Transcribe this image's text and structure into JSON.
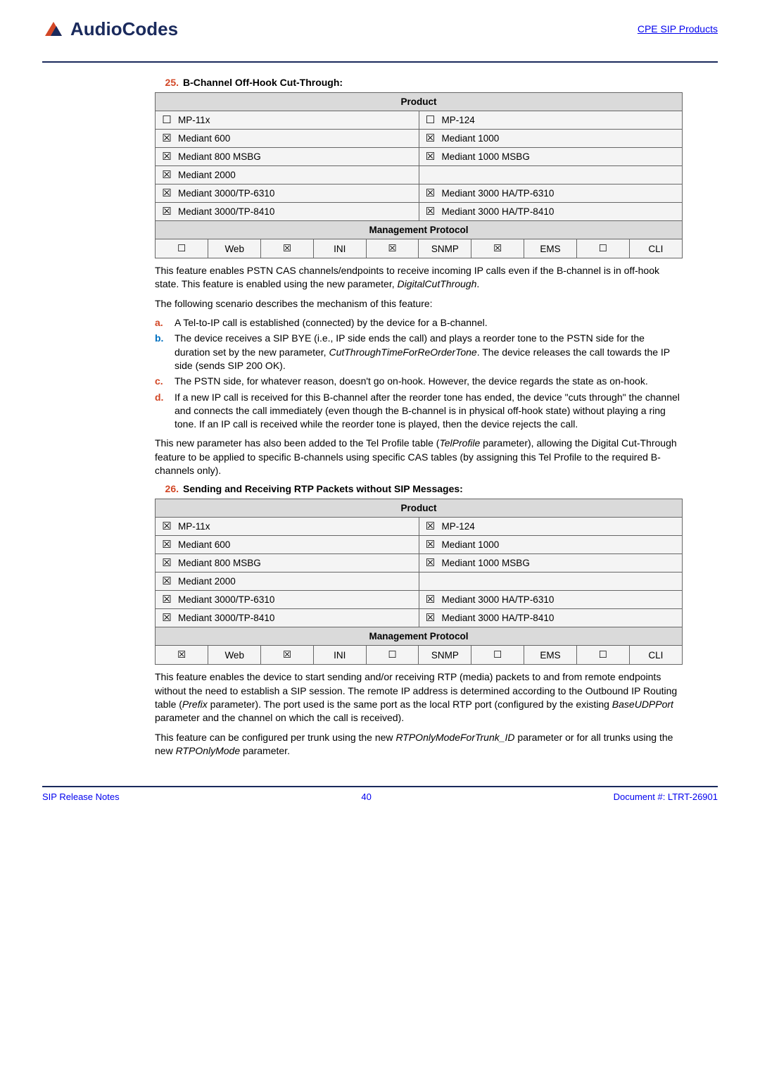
{
  "header": {
    "logo_text": "AudioCodes",
    "product_link": "CPE SIP Products"
  },
  "item25": {
    "number": "25.",
    "title": "B-Channel Off-Hook Cut-Through:",
    "table": {
      "head": "Product",
      "rows": [
        {
          "l_chk": "☐",
          "l": "MP-11x",
          "r_chk": "☐",
          "r": "MP-124"
        },
        {
          "l_chk": "☒",
          "l": "Mediant 600",
          "r_chk": "☒",
          "r": "Mediant 1000"
        },
        {
          "l_chk": "☒",
          "l": "Mediant 800 MSBG",
          "r_chk": "☒",
          "r": "Mediant 1000 MSBG"
        },
        {
          "l_chk": "☒",
          "l": "Mediant 2000",
          "r_chk": "",
          "r": ""
        },
        {
          "l_chk": "☒",
          "l": "Mediant 3000/TP-6310",
          "r_chk": "☒",
          "r": "Mediant 3000 HA/TP-6310"
        },
        {
          "l_chk": "☒",
          "l": "Mediant 3000/TP-8410",
          "r_chk": "☒",
          "r": "Mediant 3000 HA/TP-8410"
        }
      ],
      "mgmt_head": "Management Protocol",
      "mgmt": {
        "web_chk": "☐",
        "web": "Web",
        "ini_chk": "☒",
        "ini": "INI",
        "snmp_chk": "☒",
        "snmp": "SNMP",
        "ems_chk": "☒",
        "ems": "EMS",
        "cli_chk": "☐",
        "cli": "CLI"
      }
    },
    "para1_a": "This feature enables PSTN CAS channels/endpoints to receive incoming IP calls even if the B-channel is in off-hook state. This feature is enabled using the new parameter, ",
    "para1_i": "DigitalCutThrough",
    "para1_b": ".",
    "para2": "The following scenario describes the mechanism of this feature:",
    "list": [
      {
        "letter": "a.",
        "color": "red",
        "text": "A Tel-to-IP call is established (connected) by the device for a B-channel."
      },
      {
        "letter": "b.",
        "color": "blue",
        "text_a": "The device receives a SIP BYE (i.e., IP side ends the call) and plays a reorder tone to the PSTN side for the duration set by the new parameter, ",
        "text_i": "CutThroughTimeForReOrderTone",
        "text_b": ". The device releases the call towards the IP side (sends SIP 200 OK)."
      },
      {
        "letter": "c.",
        "color": "red",
        "text": "The PSTN side, for whatever reason, doesn't go on-hook. However, the device regards the state as on-hook."
      },
      {
        "letter": "d.",
        "color": "red",
        "text": "If a new IP call is received for this B-channel after the reorder tone has ended, the device \"cuts through\" the channel and connects the call immediately (even though the B-channel is in physical off-hook state) without playing a ring tone. If an IP call is received while the reorder tone is played, then the device rejects the call."
      }
    ],
    "para3_a": "This new parameter has also been added to the Tel Profile table (",
    "para3_i": "TelProfile",
    "para3_b": " parameter), allowing the Digital Cut-Through feature to be applied to specific B-channels using specific CAS tables (by assigning this Tel Profile to the required B-channels only)."
  },
  "item26": {
    "number": "26.",
    "title": "Sending and Receiving RTP Packets without SIP Messages:",
    "table": {
      "head": "Product",
      "rows": [
        {
          "l_chk": "☒",
          "l": "MP-11x",
          "r_chk": "☒",
          "r": "MP-124"
        },
        {
          "l_chk": "☒",
          "l": "Mediant 600",
          "r_chk": "☒",
          "r": "Mediant 1000"
        },
        {
          "l_chk": "☒",
          "l": "Mediant 800 MSBG",
          "r_chk": "☒",
          "r": "Mediant 1000 MSBG"
        },
        {
          "l_chk": "☒",
          "l": "Mediant 2000",
          "r_chk": "",
          "r": ""
        },
        {
          "l_chk": "☒",
          "l": "Mediant 3000/TP-6310",
          "r_chk": "☒",
          "r": "Mediant 3000 HA/TP-6310"
        },
        {
          "l_chk": "☒",
          "l": "Mediant 3000/TP-8410",
          "r_chk": "☒",
          "r": "Mediant 3000 HA/TP-8410"
        }
      ],
      "mgmt_head": "Management Protocol",
      "mgmt": {
        "web_chk": "☒",
        "web": "Web",
        "ini_chk": "☒",
        "ini": "INI",
        "snmp_chk": "☐",
        "snmp": "SNMP",
        "ems_chk": "☐",
        "ems": "EMS",
        "cli_chk": "☐",
        "cli": "CLI"
      }
    },
    "para1_a": "This feature enables the device to start sending and/or receiving RTP (media) packets to and from remote endpoints without the need to establish a SIP session. The remote IP address is determined according to the Outbound IP Routing table (",
    "para1_i": "Prefix",
    "para1_b": " parameter). The port used is the same port as the local RTP port (configured by the existing ",
    "para1_i2": "BaseUDPPort",
    "para1_c": " parameter and the channel on which the call is received).",
    "para2_a": "This feature can be configured per trunk using the new ",
    "para2_i": "RTPOnlyModeForTrunk_ID",
    "para2_b": " parameter or for all trunks using the new ",
    "para2_i2": "RTPOnlyMode",
    "para2_c": " parameter."
  },
  "footer": {
    "left": "SIP Release Notes",
    "mid": "40",
    "right": "Document #: LTRT-26901"
  }
}
